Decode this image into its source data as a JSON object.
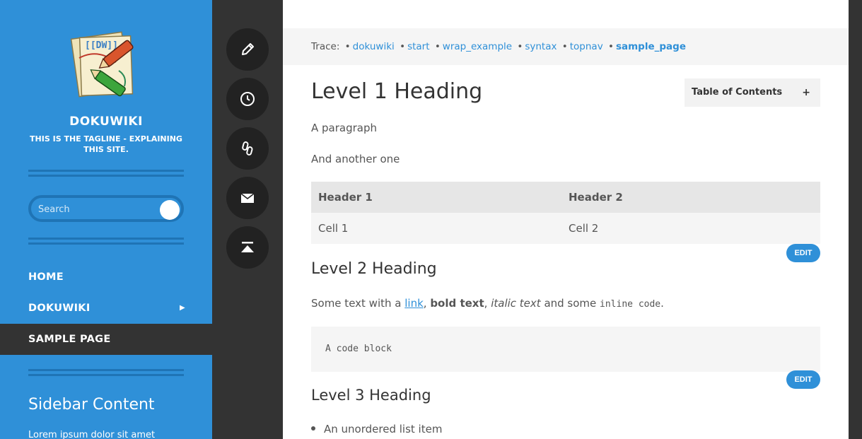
{
  "sidebar": {
    "site_title": "DOKUWIKI",
    "tagline": "THIS IS THE TAGLINE - EXPLAINING THIS SITE.",
    "search_placeholder": "Search",
    "nav": [
      {
        "label": "HOME"
      },
      {
        "label": "DOKUWIKI"
      },
      {
        "label": "SAMPLE PAGE"
      }
    ],
    "content_heading": "Sidebar Content",
    "content_text": "Lorem ipsum dolor sit amet"
  },
  "tools": [
    "edit-icon",
    "history-icon",
    "link-icon",
    "mail-icon",
    "back-to-top-icon"
  ],
  "breadcrumbs": {
    "label": "Trace:",
    "items": [
      "dokuwiki",
      "start",
      "wrap_example",
      "syntax",
      "topnav",
      "sample_page"
    ]
  },
  "content": {
    "h1": "Level 1 Heading",
    "toc_label": "Table of Contents",
    "toc_toggle": "+",
    "para1": "A paragraph",
    "para2": "And another one",
    "table": {
      "headers": [
        "Header 1",
        "Header 2"
      ],
      "rows": [
        [
          "Cell 1",
          "Cell 2"
        ]
      ]
    },
    "edit_label": "EDIT",
    "h2": "Level 2 Heading",
    "rich": {
      "t1": "Some text with a ",
      "link": "link",
      "t2": ", ",
      "bold": "bold text",
      "t3": ", ",
      "italic": "italic text",
      "t4": " and some ",
      "code": "inline code",
      "t5": "."
    },
    "codeblock": "A code block",
    "h3": "Level 3 Heading",
    "list_item": "An unordered list item"
  },
  "colors": {
    "accent": "#2f90d8",
    "accent_dark": "#1f74b5",
    "dark": "#333333"
  }
}
